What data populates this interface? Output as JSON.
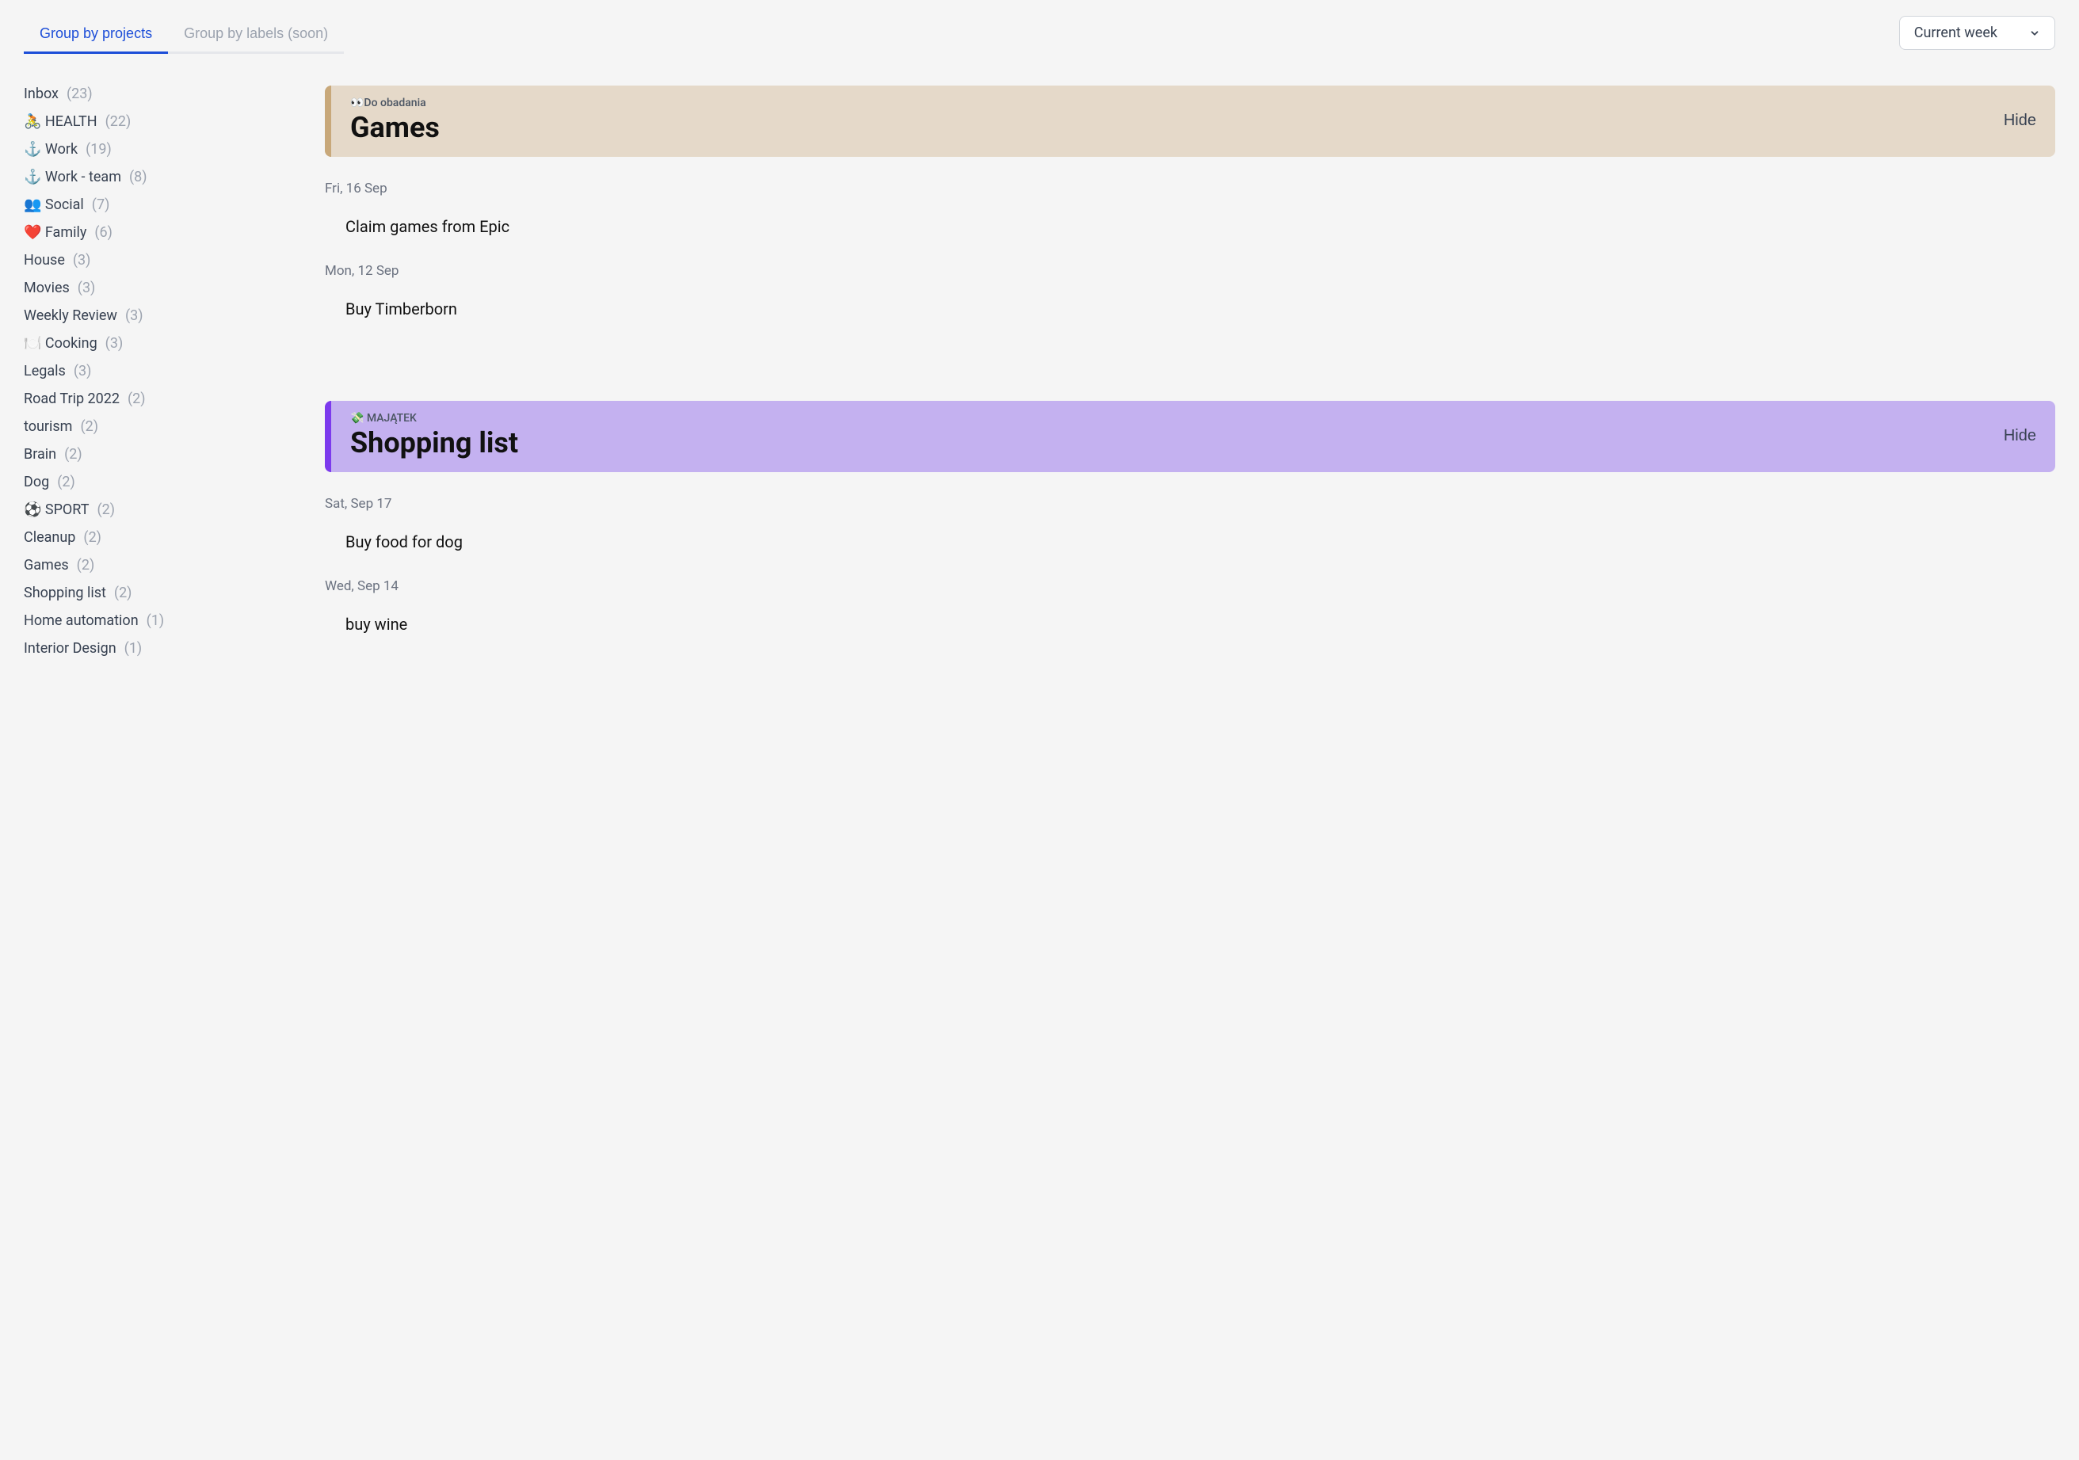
{
  "tabs": {
    "group_by_projects": "Group by projects",
    "group_by_labels": "Group by labels (soon)"
  },
  "week_selector": "Current week",
  "sidebar": {
    "items": [
      {
        "label": "Inbox",
        "count": "(23)"
      },
      {
        "label": "🚴 HEALTH",
        "count": "(22)"
      },
      {
        "label": "⚓ Work",
        "count": "(19)"
      },
      {
        "label": "⚓ Work - team",
        "count": "(8)"
      },
      {
        "label": "👥 Social",
        "count": "(7)"
      },
      {
        "label": "❤️ Family",
        "count": "(6)"
      },
      {
        "label": "House",
        "count": "(3)"
      },
      {
        "label": "Movies",
        "count": "(3)"
      },
      {
        "label": "Weekly Review",
        "count": "(3)"
      },
      {
        "label": "🍽️ Cooking",
        "count": "(3)"
      },
      {
        "label": "Legals",
        "count": "(3)"
      },
      {
        "label": "Road Trip 2022",
        "count": "(2)"
      },
      {
        "label": "tourism",
        "count": "(2)"
      },
      {
        "label": "Brain",
        "count": "(2)"
      },
      {
        "label": "Dog",
        "count": "(2)"
      },
      {
        "label": "⚽ SPORT",
        "count": "(2)"
      },
      {
        "label": "Cleanup",
        "count": "(2)"
      },
      {
        "label": "Games",
        "count": "(2)"
      },
      {
        "label": "Shopping list",
        "count": "(2)"
      },
      {
        "label": "Home automation",
        "count": "(1)"
      },
      {
        "label": "Interior Design",
        "count": "(1)"
      }
    ]
  },
  "sections": {
    "games": {
      "breadcrumb": "👀Do obadania",
      "title": "Games",
      "hide": "Hide",
      "groups": [
        {
          "date": "Fri, 16 Sep",
          "task": "Claim games from Epic"
        },
        {
          "date": "Mon, 12 Sep",
          "task": "Buy Timberborn"
        }
      ]
    },
    "shopping": {
      "breadcrumb": "💸 MAJĄTEK",
      "title": "Shopping list",
      "hide": "Hide",
      "groups": [
        {
          "date": "Sat, Sep 17",
          "task": "Buy food for dog"
        },
        {
          "date": "Wed, Sep 14",
          "task": "buy wine"
        }
      ]
    }
  }
}
